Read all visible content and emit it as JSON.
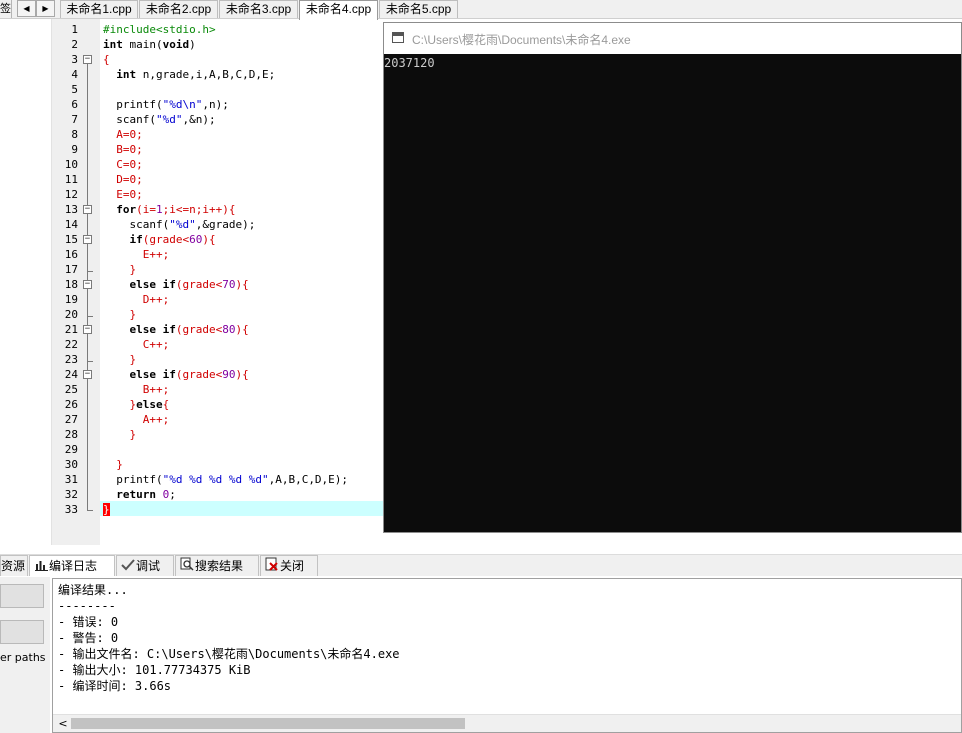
{
  "file_tabs": {
    "left_stub": "签",
    "nav_left": "◀",
    "nav_right": "▶",
    "tabs": [
      {
        "label": "未命名1.cpp"
      },
      {
        "label": "未命名2.cpp"
      },
      {
        "label": "未命名3.cpp"
      },
      {
        "label": "未命名4.cpp",
        "active": true
      },
      {
        "label": "未命名5.cpp"
      }
    ]
  },
  "editor": {
    "line_numbers": [
      "1",
      "2",
      "3",
      "4",
      "5",
      "6",
      "7",
      "8",
      "9",
      "10",
      "11",
      "12",
      "13",
      "14",
      "15",
      "16",
      "17",
      "18",
      "19",
      "20",
      "21",
      "22",
      "23",
      "24",
      "25",
      "26",
      "27",
      "28",
      "29",
      "30",
      "31",
      "32",
      "33"
    ],
    "code": {
      "l1": "#include<stdio.h>",
      "l2_kw": "int",
      "l2_rest": " main(",
      "l2_void": "void",
      "l2_end": ")",
      "l3": "{",
      "l4_kw": "  int",
      "l4_rest": " n,grade,i,A,B,C,D,E;",
      "l6_fn": "  printf(",
      "l6_str": "\"%d\\n\"",
      "l6_end": ",n);",
      "l7_fn": "  scanf(",
      "l7_str": "\"%d\"",
      "l7_end": ",&n);",
      "l8": "  A=0;",
      "l9": "  B=0;",
      "l10": "  C=0;",
      "l11": "  D=0;",
      "l12": "  E=0;",
      "l13_kw": "  for",
      "l13_a": "(i=",
      "l13_b": "1",
      "l13_c": ";i<=n;i++){",
      "l14_fn": "    scanf(",
      "l14_str": "\"%d\"",
      "l14_end": ",&grade);",
      "l15_kw": "    if",
      "l15_a": "(grade<",
      "l15_b": "60",
      "l15_c": "){",
      "l16": "      E++;",
      "l17": "    }",
      "l18_kw": "    else if",
      "l18_a": "(grade<",
      "l18_b": "70",
      "l18_c": "){",
      "l19": "      D++;",
      "l20": "    }",
      "l21_kw": "    else if",
      "l21_a": "(grade<",
      "l21_b": "80",
      "l21_c": "){",
      "l22": "      C++;",
      "l23": "    }",
      "l24_kw": "    else if",
      "l24_a": "(grade<",
      "l24_b": "90",
      "l24_c": "){",
      "l25": "      B++;",
      "l26_a": "    }",
      "l26_kw": "else",
      "l26_c": "{",
      "l27": "      A++;",
      "l28": "    }",
      "l30": "  }",
      "l31_fn": "  printf(",
      "l31_str": "\"%d %d %d %d %d\"",
      "l31_end": ",A,B,C,D,E);",
      "l32_kw": "  return",
      "l32_sp": " ",
      "l32_num": "0",
      "l32_end": ";",
      "l33": "}"
    }
  },
  "console": {
    "title": "C:\\Users\\樱花雨\\Documents\\未命名4.exe",
    "output": "2037120"
  },
  "bottom_tabs": [
    {
      "label": "资源",
      "icon": "resources-icon"
    },
    {
      "label": "编译日志",
      "icon": "bar-chart-icon",
      "active": true
    },
    {
      "label": "调试",
      "icon": "checkmark-icon"
    },
    {
      "label": "搜索结果",
      "icon": "search-icon"
    },
    {
      "label": "关闭",
      "icon": "close-icon"
    }
  ],
  "bottom_left": {
    "paths_label": "er paths"
  },
  "log": {
    "lines": [
      "编译结果...",
      "--------",
      "- 错误: 0",
      "- 警告: 0",
      "- 输出文件名: C:\\Users\\樱花雨\\Documents\\未命名4.exe",
      "- 输出大小: 101.77734375 KiB",
      "- 编译时间: 3.66s"
    ],
    "scroll_left": "<"
  }
}
